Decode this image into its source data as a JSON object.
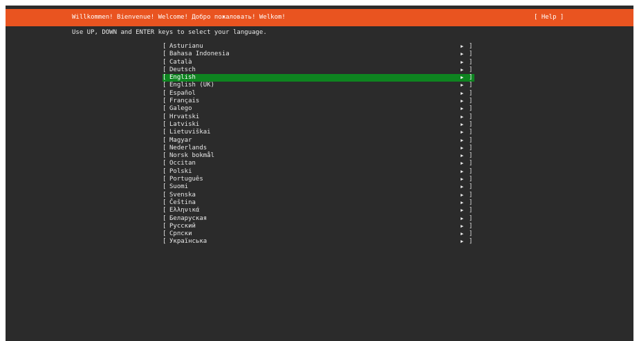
{
  "header": {
    "title": "Willkommen! Bienvenue! Welcome! Добро пожаловать! Welkom!",
    "help_label": "[ Help ]"
  },
  "instructions": "Use UP, DOWN and ENTER keys to select your language.",
  "languages": [
    "Asturianu",
    "Bahasa Indonesia",
    "Català",
    "Deutsch",
    "English",
    "English (UK)",
    "Español",
    "Français",
    "Galego",
    "Hrvatski",
    "Latviski",
    "Lietuviškai",
    "Magyar",
    "Nederlands",
    "Norsk bokmål",
    "Occitan",
    "Polski",
    "Português",
    "Suomi",
    "Svenska",
    "Čeština",
    "Ελληνικά",
    "Беларуская",
    "Русский",
    "Српски",
    "Українська"
  ],
  "selected_language": "English",
  "list_glyphs": {
    "left_bracket": "[",
    "arrow": "▶",
    "right_bracket": "]"
  },
  "colors": {
    "header_background": "#e95420",
    "selection_background": "#0e8420",
    "screen_background": "#2b2b2b",
    "text": "#e8e8e8"
  }
}
